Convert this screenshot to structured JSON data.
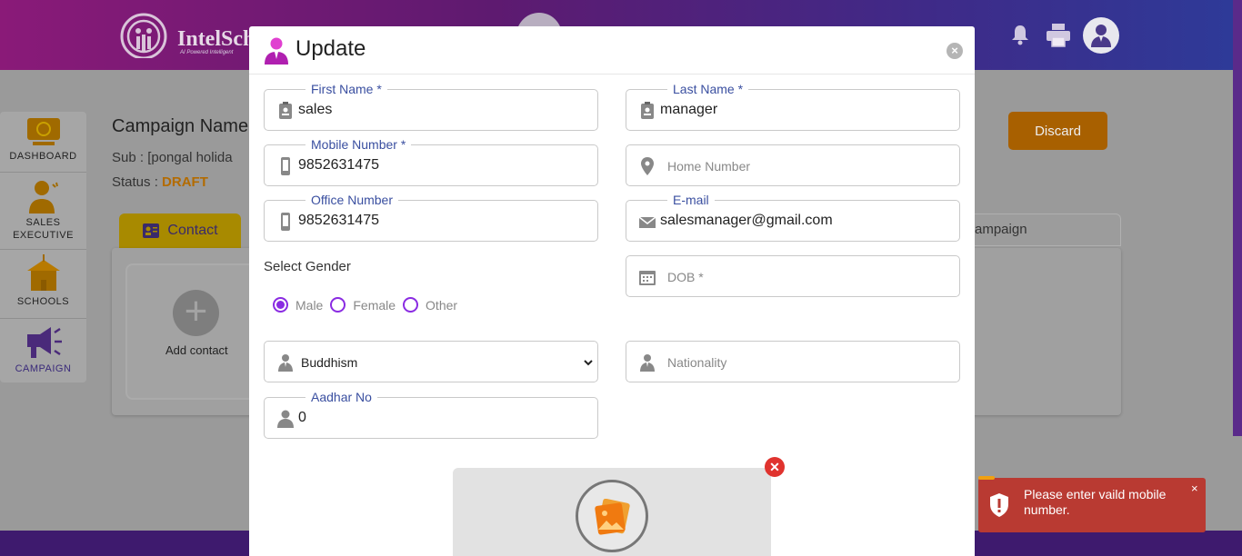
{
  "app": {
    "brand": "IntelSch",
    "tagline": "AI Powered Intelligent"
  },
  "sidebar": {
    "items": [
      {
        "label": "DASHBOARD",
        "icon": "dashboard-icon"
      },
      {
        "label": "SALES",
        "label2": "EXECUTIVE",
        "icon": "sales-executive-icon"
      },
      {
        "label": "SCHOOLS",
        "icon": "school-icon"
      },
      {
        "label": "CAMPAIGN",
        "icon": "campaign-icon",
        "active": true
      }
    ]
  },
  "page": {
    "campaign_title": "Campaign Name",
    "sub_prefix": "Sub : ",
    "sub_value": "[pongal holida",
    "status_prefix": "Status : ",
    "status_value": "DRAFT",
    "discard_label": "Discard",
    "tab_contact": "Contact",
    "tab_campaign": "ampaign",
    "add_contact": "Add contact"
  },
  "modal": {
    "title": "Update",
    "close": "×",
    "fields": {
      "first_name": {
        "label": "First Name *",
        "value": "sales"
      },
      "last_name": {
        "label": "Last Name *",
        "value": "manager"
      },
      "mobile": {
        "label": "Mobile Number *",
        "value": "9852631475"
      },
      "home": {
        "placeholder": "Home Number"
      },
      "office": {
        "label": "Office Number",
        "value": "9852631475"
      },
      "email": {
        "label": "E-mail",
        "value": "salesmanager@gmail.com"
      },
      "dob": {
        "placeholder": "DOB *"
      },
      "religion": {
        "value": "Buddhism"
      },
      "nationality": {
        "placeholder": "Nationality"
      },
      "aadhar": {
        "label": "Aadhar No",
        "value": "0"
      }
    },
    "gender": {
      "label": "Select Gender",
      "options": [
        "Male",
        "Female",
        "Other"
      ],
      "selected": "Male"
    },
    "upload_remove": "✕"
  },
  "toast": {
    "message": "Please enter vaild mobile number.",
    "close": "×"
  },
  "colors": {
    "accent": "#8a2be2",
    "legend": "#3a4fa0",
    "toast_bg": "#b93a32",
    "status": "#b36b00"
  }
}
